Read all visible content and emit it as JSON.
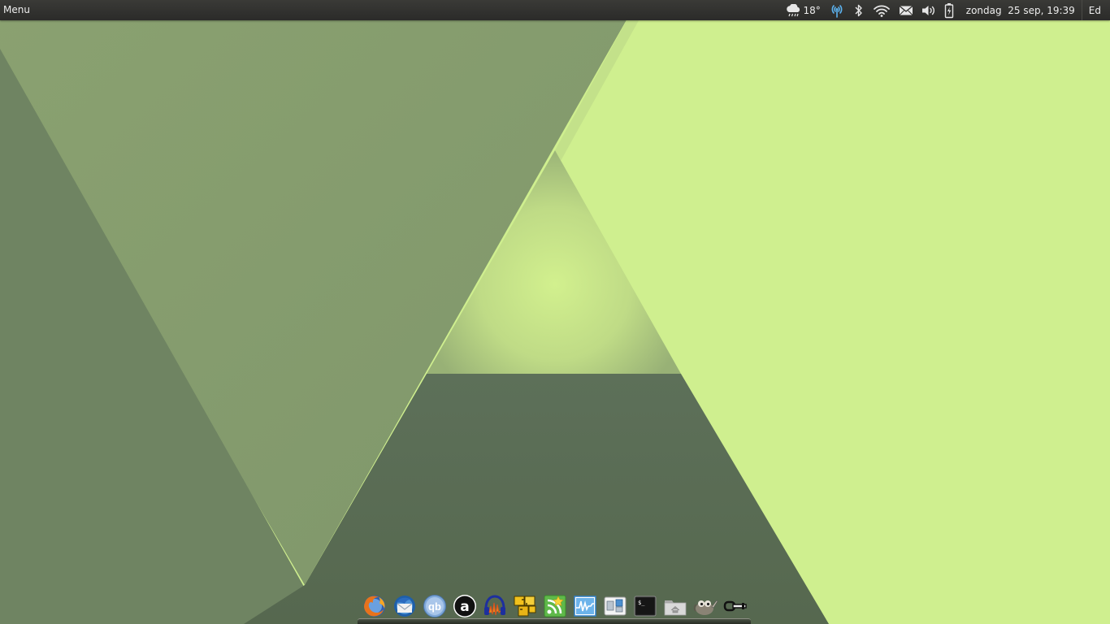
{
  "panel": {
    "menu_label": "Menu",
    "weather_temp": "18°",
    "clock": "zondag  25 sep, 19:39",
    "user": "Ed",
    "indicators": [
      "weather-rain-icon",
      "hotspot-icon",
      "bluetooth-icon",
      "wifi-icon",
      "mail-icon",
      "volume-icon",
      "battery-icon"
    ]
  },
  "dock": {
    "launchers": [
      "firefox-icon",
      "thunderbird-icon",
      "qbittorrent-icon",
      "amarok-icon",
      "audacity-icon",
      "puzzle-game-icon",
      "rss-reader-icon",
      "system-monitor-icon",
      "workspace-switcher-icon",
      "terminal-icon",
      "home-folder-icon",
      "gimp-icon",
      "tool-icon"
    ]
  },
  "colors": {
    "panel_bg": "#2e2e2c",
    "wallpaper_light": "#cfef8f",
    "wallpaper_mid": "#849b6d",
    "wallpaper_dark": "#5b6e58"
  }
}
